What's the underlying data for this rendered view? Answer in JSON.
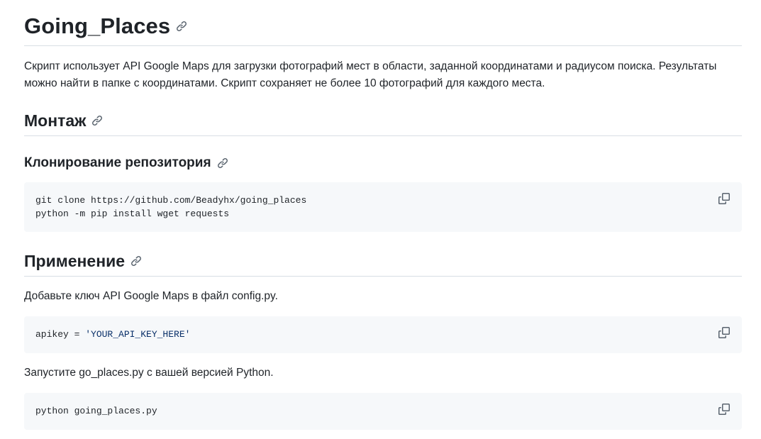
{
  "readme": {
    "title": "Going_Places",
    "intro": "Скрипт использует API Google Maps для загрузки фотографий мест в области, заданной координатами и радиусом поиска. Результаты можно найти в папке с координатами. Скрипт сохраняет не более 10 фотографий для каждого места.",
    "install": {
      "heading": "Монтаж",
      "clone_heading": "Клонирование репозитория",
      "code_line1": "git clone https://github.com/Beadyhx/going_places",
      "code_line2": "python -m pip install wget requests"
    },
    "usage": {
      "heading": "Применение",
      "text1": "Добавьте ключ API Google Maps в файл config.py.",
      "code1_prefix": "apikey = ",
      "code1_string": "'YOUR_API_KEY_HERE'",
      "text2": "Запустите go_places.py с вашей версией Python.",
      "code2": "python going_places.py"
    }
  },
  "icons": {
    "anchor": "link-icon",
    "copy": "copy-icon"
  },
  "colors": {
    "text": "#1f2328",
    "muted": "#59636e",
    "code_bg": "#f6f8fa",
    "border": "#d8dee4",
    "string": "#0a3069"
  }
}
